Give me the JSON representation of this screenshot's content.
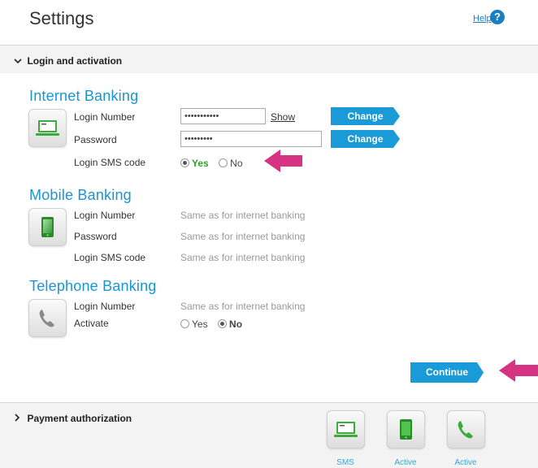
{
  "header": {
    "title": "Settings",
    "help_label": "Help",
    "help_icon": "?"
  },
  "login_bar": {
    "label": "Login and activation",
    "icon": "chevron-down"
  },
  "internet": {
    "title": "Internet Banking",
    "login_number_label": "Login Number",
    "login_number_value": "•••••••••••",
    "show_label": "Show",
    "password_label": "Password",
    "password_value": "•••••••••",
    "change_label_1": "Change",
    "change_label_2": "Change",
    "sms_label": "Login SMS code",
    "sms_yes": "Yes",
    "sms_no": "No",
    "sms_selected": "Yes"
  },
  "mobile": {
    "title": "Mobile Banking",
    "login_number_label": "Login Number",
    "login_number_value": "Same as for internet banking",
    "password_label": "Password",
    "password_value": "Same as for internet banking",
    "sms_label": "Login SMS code",
    "sms_value": "Same as for internet banking"
  },
  "telephone": {
    "title": "Telephone Banking",
    "login_number_label": "Login Number",
    "login_number_value": "Same as for internet banking",
    "activate_label": "Activate",
    "activate_yes": "Yes",
    "activate_no": "No",
    "activate_selected": "No"
  },
  "continue_label": "Continue",
  "payment_bar": {
    "label": "Payment authorization",
    "icon": "chevron-right"
  },
  "payment_methods": [
    {
      "icon": "laptop-icon",
      "status": "SMS"
    },
    {
      "icon": "mobile-icon",
      "status": "Active"
    },
    {
      "icon": "phone-icon",
      "status": "Active"
    }
  ],
  "colors": {
    "accent": "#1a9ad6",
    "title_blue": "#1a95d3",
    "annotation_pink": "#d63384",
    "green": "#2f9e2f"
  }
}
